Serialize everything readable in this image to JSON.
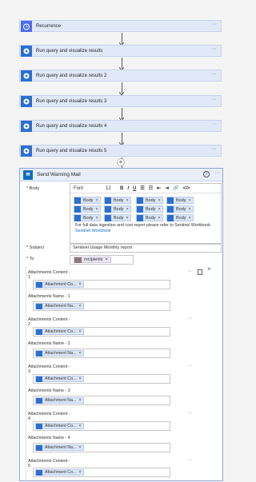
{
  "steps": [
    {
      "title": "Recurrence",
      "icon": "clock-icon",
      "color": "#4f6bed"
    },
    {
      "title": "Run query and visualize results",
      "icon": "log-analytics-icon",
      "color": "#2b6fd1"
    },
    {
      "title": "Run query and visualize results 2",
      "icon": "log-analytics-icon",
      "color": "#2b6fd1"
    },
    {
      "title": "Run query and visualize results 3",
      "icon": "log-analytics-icon",
      "color": "#2b6fd1"
    },
    {
      "title": "Run query and visualize results 4",
      "icon": "log-analytics-icon",
      "color": "#2b6fd1"
    },
    {
      "title": "Run query and visualize results 5",
      "icon": "log-analytics-icon",
      "color": "#2b6fd1"
    }
  ],
  "more_glyph": "···",
  "add_glyph": "+",
  "send_mail": {
    "title": "Send Warning Mail",
    "info": "i",
    "body_label": "* Body",
    "toolbar": {
      "font": "Font",
      "size": "12",
      "bold": "B",
      "italic": "I",
      "underline": "U"
    },
    "body_tokens": [
      "Body",
      "Body",
      "Body",
      "Body",
      "Body",
      "Body",
      "Body",
      "Body",
      "Body",
      "Body",
      "Body",
      "Body"
    ],
    "body_text": "For full data ingestion and cost report please refer to Sentinel Workbook:",
    "body_link": "Sentinel Workbook",
    "subject_label": "* Subject",
    "subject_value": "Sentinel Usage Monthly report",
    "to_label": "* To",
    "to_value": "recipients",
    "token_close": "×"
  },
  "attachments": [
    {
      "label": "Attachments Content -",
      "index": "1",
      "token": "Attachment Co..."
    },
    {
      "label": "Attachments Name - 1",
      "index": "",
      "token": "Attachment Na..."
    },
    {
      "label": "Attachments Content -",
      "index": "2",
      "token": "Attachment Co..."
    },
    {
      "label": "Attachments Name - 2",
      "index": "",
      "token": "Attachment Na..."
    },
    {
      "label": "Attachments Content -",
      "index": "3",
      "token": "Attachment Co..."
    },
    {
      "label": "Attachments Name - 3",
      "index": "",
      "token": "Attachment Na..."
    },
    {
      "label": "Attachments Content -",
      "index": "4",
      "token": "Attachment Co..."
    },
    {
      "label": "Attachments Name - 4",
      "index": "",
      "token": "Attachment Na..."
    },
    {
      "label": "Attachments Content -",
      "index": "5",
      "token": "Attachment Co..."
    }
  ],
  "close_glyph": "×"
}
